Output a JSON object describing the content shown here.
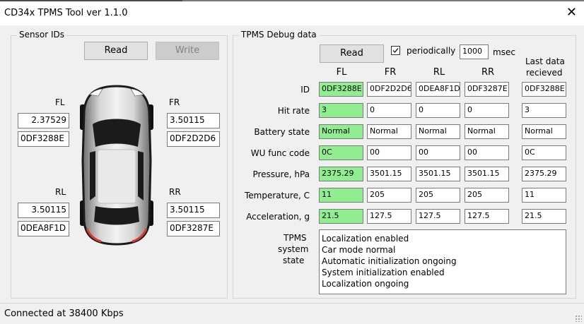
{
  "window": {
    "title": "CD34x TPMS Tool ver 1.1.0",
    "close_glyph": "✕"
  },
  "sensor_ids": {
    "group_title": "Sensor IDs",
    "read_label": "Read",
    "write_label": "Write",
    "fl": {
      "label": "FL",
      "value": "2.37529",
      "id": "0DF3288E"
    },
    "fr": {
      "label": "FR",
      "value": "3.50115",
      "id": "0DF2D2D6"
    },
    "rl": {
      "label": "RL",
      "value": "3.50115",
      "id": "0DEA8F1D"
    },
    "rr": {
      "label": "RR",
      "value": "3.50115",
      "id": "0DF3287E"
    },
    "car_icon": "car-top-view-icon"
  },
  "debug": {
    "group_title": "TPMS Debug data",
    "read_label": "Read",
    "periodically_label": "periodically",
    "periodically_checked": true,
    "interval": "1000",
    "interval_unit": "msec",
    "columns": [
      "FL",
      "FR",
      "RL",
      "RR"
    ],
    "last_header_line1": "Last data",
    "last_header_line2": "recieved",
    "rows": [
      {
        "label": "ID",
        "values": [
          "0DF3288E",
          "0DF2D2D6",
          "0DEA8F1D",
          "0DF3287E"
        ],
        "last": "0DF3288E"
      },
      {
        "label": "Hit rate",
        "values": [
          "3",
          "0",
          "0",
          "0"
        ],
        "last": "3"
      },
      {
        "label": "Battery state",
        "values": [
          "Normal",
          "Normal",
          "Normal",
          "Normal"
        ],
        "last": "Normal"
      },
      {
        "label": "WU func code",
        "values": [
          "0C",
          "00",
          "00",
          "00"
        ],
        "last": "0C"
      },
      {
        "label": "Pressure, hPa",
        "values": [
          "2375.29",
          "3501.15",
          "3501.15",
          "3501.15"
        ],
        "last": "2375.29"
      },
      {
        "label": "Temperature, C",
        "values": [
          "11",
          "205",
          "205",
          "205"
        ],
        "last": "11"
      },
      {
        "label": "Acceleration, g",
        "values": [
          "21.5",
          "127.5",
          "127.5",
          "127.5"
        ],
        "last": "21.5"
      }
    ],
    "system_state_label": [
      "TPMS",
      "system",
      "state"
    ],
    "system_state_lines": [
      "Localization enabled",
      "Car mode normal",
      "Automatic initialization ongoing",
      "System initialization enabled",
      "Localization ongoing"
    ],
    "highlight_color": "#90ee90"
  },
  "status": {
    "text": "Connected at 38400 Kbps"
  }
}
